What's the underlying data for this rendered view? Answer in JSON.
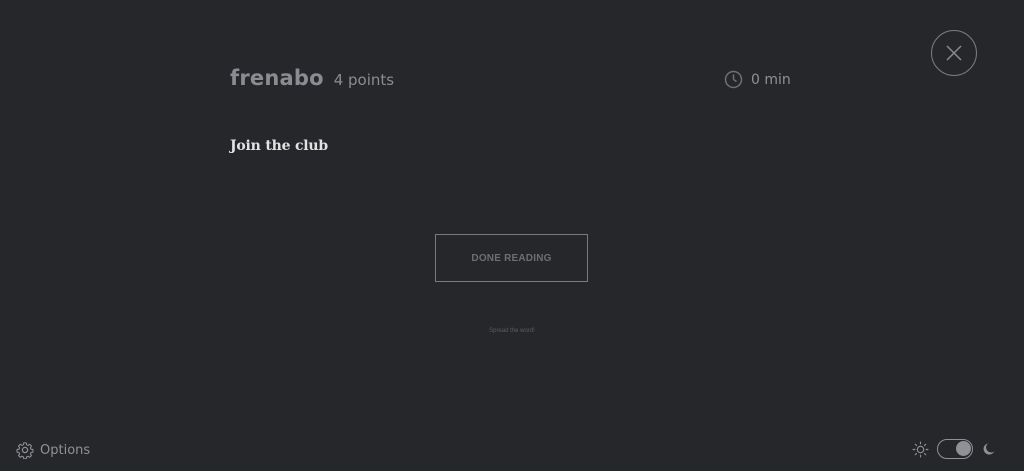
{
  "header": {
    "author": "frenabo",
    "points": "4 points",
    "read_time": "0 min"
  },
  "story": {
    "text": "Join the club"
  },
  "actions": {
    "done_label": "DONE READING",
    "spread_label": "Spread the word!"
  },
  "footer": {
    "options_label": "Options",
    "theme_mode": "dark"
  },
  "icons": {
    "close": "close-icon",
    "clock": "clock-icon",
    "gear": "gear-icon",
    "sun": "sun-icon",
    "moon": "moon-icon"
  },
  "colors": {
    "background": "#26272b",
    "muted_text": "#8a8c91",
    "story_text": "#e2e2e2",
    "border": "#7a7b80"
  }
}
